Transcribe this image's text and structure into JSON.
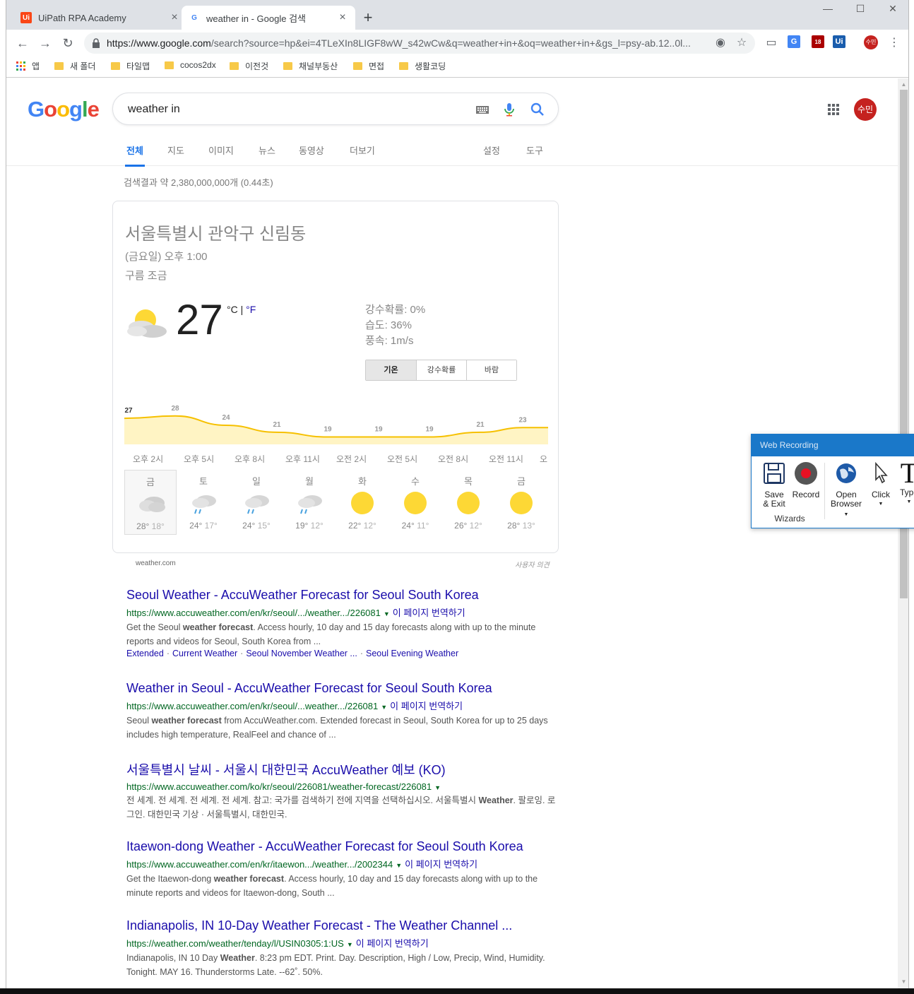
{
  "browser": {
    "tabs": [
      {
        "title": "UiPath RPA Academy",
        "favicon": "uipath-logo"
      },
      {
        "title": "weather in - Google 검색",
        "favicon": "google-g"
      }
    ],
    "url_host": "https://www.google.com",
    "url_rest": "/search?source=hp&ei=4TLeXIn8LIGF8wW_s42wCw&q=weather+in+&oq=weather+in+&gs_l=psy-ab.12..0l...",
    "bookmarks": [
      "앱",
      "새 폴더",
      "타일맵",
      "cocos2dx",
      "이전것",
      "채널부동산",
      "면접",
      "생활코딩"
    ],
    "profile_label": "수민",
    "extension_badge": "18"
  },
  "google": {
    "logo": "Google",
    "query": "weather in",
    "avatar_label": "수민",
    "tabs": [
      "전체",
      "지도",
      "이미지",
      "뉴스",
      "동영상",
      "더보기"
    ],
    "settings_label": "설정",
    "tools_label": "도구",
    "stats": "검색결과 약 2,380,000,000개 (0.44초)"
  },
  "weather": {
    "location": "서울특별시 관악구 신림동",
    "time": "(금요일) 오후 1:00",
    "condition": "구름 조금",
    "temp": "27",
    "unit_c": "°C",
    "unit_sep": " | ",
    "unit_f": "°F",
    "precip": "강수확률: 0%",
    "humidity": "습도: 36%",
    "wind": "풍속: 1m/s",
    "toggle": [
      "기온",
      "강수확률",
      "바람"
    ],
    "chart_labels": [
      "27",
      "28",
      "24",
      "21",
      "19",
      "19",
      "19",
      "21",
      "23"
    ],
    "hours": [
      "오후 2시",
      "오후 5시",
      "오후 8시",
      "오후 11시",
      "오전 2시",
      "오전 5시",
      "오전 8시",
      "오전 11시",
      "오"
    ],
    "days": [
      {
        "name": "금",
        "hi": "28°",
        "lo": "18°",
        "icon": "cloudy-icon"
      },
      {
        "name": "토",
        "hi": "24°",
        "lo": "17°",
        "icon": "rain-icon"
      },
      {
        "name": "일",
        "hi": "24°",
        "lo": "15°",
        "icon": "rain-icon"
      },
      {
        "name": "월",
        "hi": "19°",
        "lo": "12°",
        "icon": "rain-icon"
      },
      {
        "name": "화",
        "hi": "22°",
        "lo": "12°",
        "icon": "sun-icon"
      },
      {
        "name": "수",
        "hi": "24°",
        "lo": "11°",
        "icon": "sun-icon"
      },
      {
        "name": "목",
        "hi": "26°",
        "lo": "12°",
        "icon": "sun-icon"
      },
      {
        "name": "금",
        "hi": "28°",
        "lo": "13°",
        "icon": "sun-icon"
      }
    ],
    "source": "weather.com",
    "feedback": "사용자 의견",
    "colors": {
      "line": "#f6c000",
      "fill": "#fff4c4",
      "sun": "#fdd835"
    }
  },
  "results": [
    {
      "title": "Seoul Weather - AccuWeather Forecast for Seoul South Korea",
      "url": "https://www.accuweather.com/en/kr/seoul/.../weather.../226081",
      "translate": "이 페이지 번역하기",
      "snippet_pre": "Get the Seoul ",
      "snippet_bold": "weather forecast",
      "snippet_post": ". Access hourly, 10 day and 15 day forecasts along with up to the minute reports and videos for Seoul, South Korea from ...",
      "links": [
        "Extended",
        "Current Weather",
        "Seoul November Weather ...",
        "Seoul Evening Weather"
      ]
    },
    {
      "title": "Weather in Seoul - AccuWeather Forecast for Seoul South Korea",
      "url": "https://www.accuweather.com/en/kr/seoul/...weather.../226081",
      "translate": "이 페이지 번역하기",
      "snippet_pre": "Seoul ",
      "snippet_bold": "weather forecast",
      "snippet_post": " from AccuWeather.com. Extended forecast in Seoul, South Korea for up to 25 days includes high temperature, RealFeel and chance of ..."
    },
    {
      "title": "서울특별시 날씨 - 서울시 대한민국 AccuWeather 예보 (KO)",
      "url": "https://www.accuweather.com/ko/kr/seoul/226081/weather-forecast/226081",
      "snippet_pre": "전 세계. 전 세계. 전 세계. 전 세계. 참고: 국가를 검색하기 전에 지역을 선택하십시오. 서울특별시 ",
      "snippet_bold": "Weather",
      "snippet_post": ". 팔로잉. 로그인. 대한민국 기상 · 서울특별시, 대한민국."
    },
    {
      "title": "Itaewon-dong Weather - AccuWeather Forecast for Seoul South Korea",
      "url": "https://www.accuweather.com/en/kr/itaewon.../weather.../2002344",
      "translate": "이 페이지 번역하기",
      "snippet_pre": "Get the Itaewon-dong ",
      "snippet_bold": "weather forecast",
      "snippet_post": ". Access hourly, 10 day and 15 day forecasts along with up to the minute reports and videos for Itaewon-dong, South ..."
    },
    {
      "title": "Indianapolis, IN 10-Day Weather Forecast - The Weather Channel ...",
      "url": "https://weather.com/weather/tenday/l/USIN0305:1:US",
      "translate": "이 페이지 번역하기",
      "snippet_pre": "Indianapolis, IN 10 Day ",
      "snippet_bold": "Weather",
      "snippet_post": ". 8:23 pm EDT. Print. Day. Description, High / Low, Precip, Wind, Humidity. Tonight. MAY 16. Thunderstorms Late. --62˚. 50%."
    }
  ],
  "recorder": {
    "title": "Web Recording",
    "buttons": {
      "save_line1": "Save",
      "save_line2": "& Exit",
      "record": "Record",
      "open_line1": "Open",
      "open_line2": "Browser",
      "click": "Click",
      "type": "Type"
    },
    "group_label": "Wizards",
    "colors": {
      "header": "#1a78c9",
      "record": "#e81123"
    }
  }
}
